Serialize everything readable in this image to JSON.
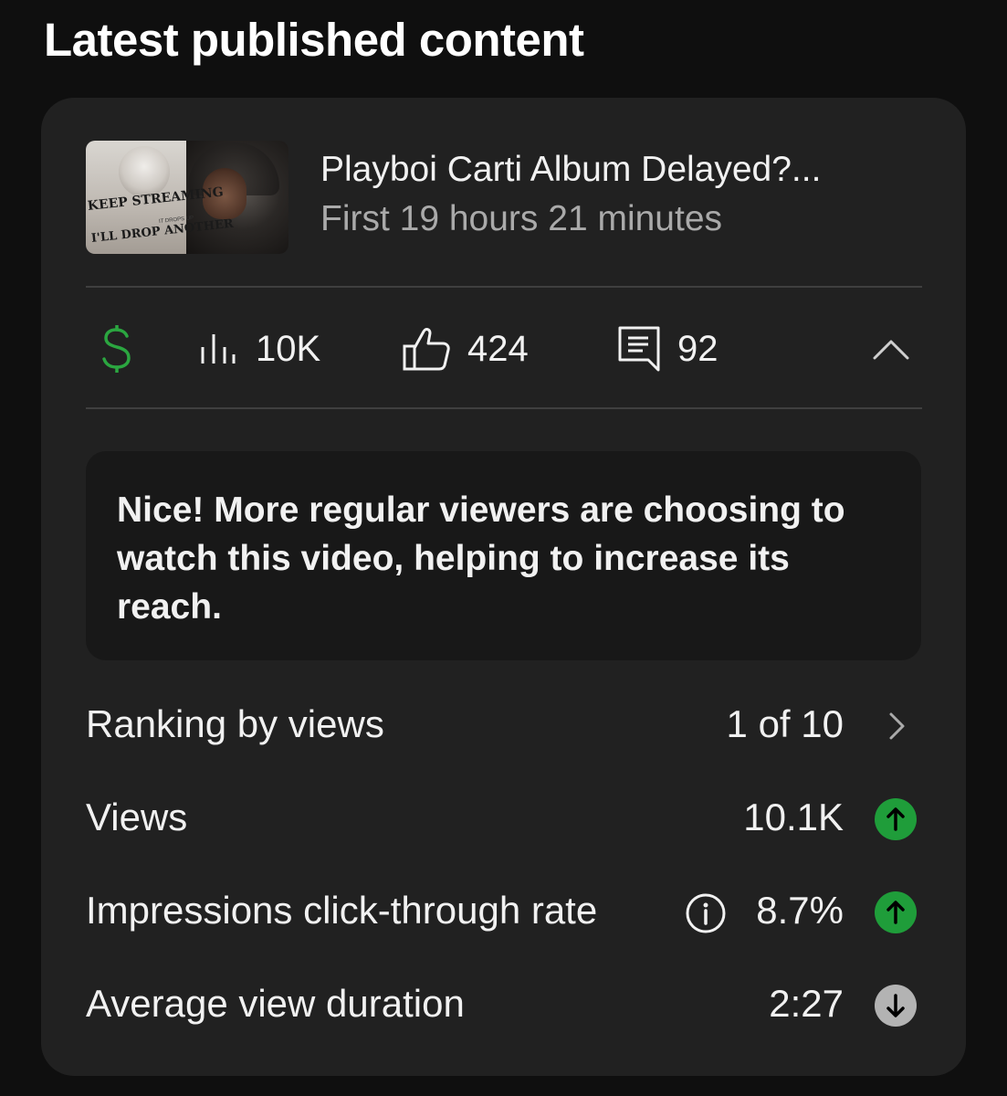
{
  "header": {
    "title": "Latest published content"
  },
  "video": {
    "title": "Playboi Carti Album Delayed?...",
    "subtitle": "First 19 hours 21 minutes",
    "thumbnail_text_1": "KEEP STREAMING",
    "thumbnail_text_2": "I'LL DROP ANOTHER",
    "thumbnail_small_text": "IT DROPS UP"
  },
  "stats": {
    "monetization_icon": "dollar-icon",
    "views_icon": "bar-chart-icon",
    "views": "10K",
    "likes_icon": "thumbs-up-icon",
    "likes": "424",
    "comments_icon": "comment-icon",
    "comments": "92",
    "collapse_icon": "chevron-up-icon"
  },
  "insight": {
    "message": "Nice! More regular viewers are choosing to watch this video, helping to increase its reach."
  },
  "metrics": [
    {
      "label": "Ranking by views",
      "value": "1 of 10",
      "icon": "chevron-right-icon"
    },
    {
      "label": "Views",
      "value": "10.1K",
      "icon": "arrow-up-icon",
      "trend": "up"
    },
    {
      "label": "Impressions click-through rate",
      "value": "8.7%",
      "icon": "arrow-up-icon",
      "trend": "up",
      "info_icon": "info-icon"
    },
    {
      "label": "Average view duration",
      "value": "2:27",
      "icon": "arrow-down-icon",
      "trend": "down"
    }
  ],
  "colors": {
    "background": "#0f0f0f",
    "card": "#212121",
    "message_box": "#181818",
    "money_green": "#2ba640",
    "trend_up": "#1f9d3a",
    "trend_down": "#b3b3b3",
    "muted_text": "#aaaaaa"
  }
}
